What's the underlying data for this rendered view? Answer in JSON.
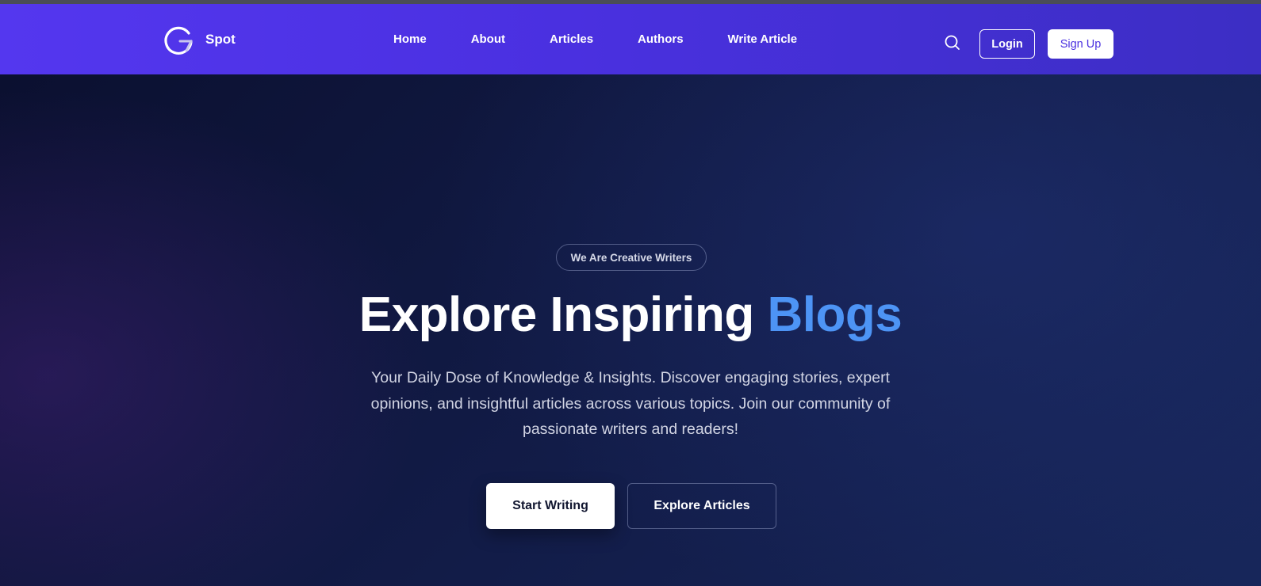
{
  "navbar": {
    "brand_name": "Spot",
    "logo_icon": "g-logo-icon",
    "links": [
      "Home",
      "About",
      "Articles",
      "Authors",
      "Write Article"
    ],
    "search_icon": "search-icon",
    "login_label": "Login",
    "signup_label": "Sign Up"
  },
  "hero": {
    "badge": "We Are Creative Writers",
    "headline_main": "Explore Inspiring",
    "headline_accent": "Blogs",
    "description": "Your Daily Dose of Knowledge & Insights. Discover engaging stories, expert opinions, and insightful articles across various topics. Join our community of passionate writers and readers!",
    "primary_cta": "Start Writing",
    "secondary_cta": "Explore Articles"
  },
  "colors": {
    "navbar_start": "#5437ef",
    "navbar_end": "#3c2ec4",
    "hero_background": "#111a44",
    "accent_blue": "#4d94f5",
    "signup_text": "#4a30e0"
  }
}
